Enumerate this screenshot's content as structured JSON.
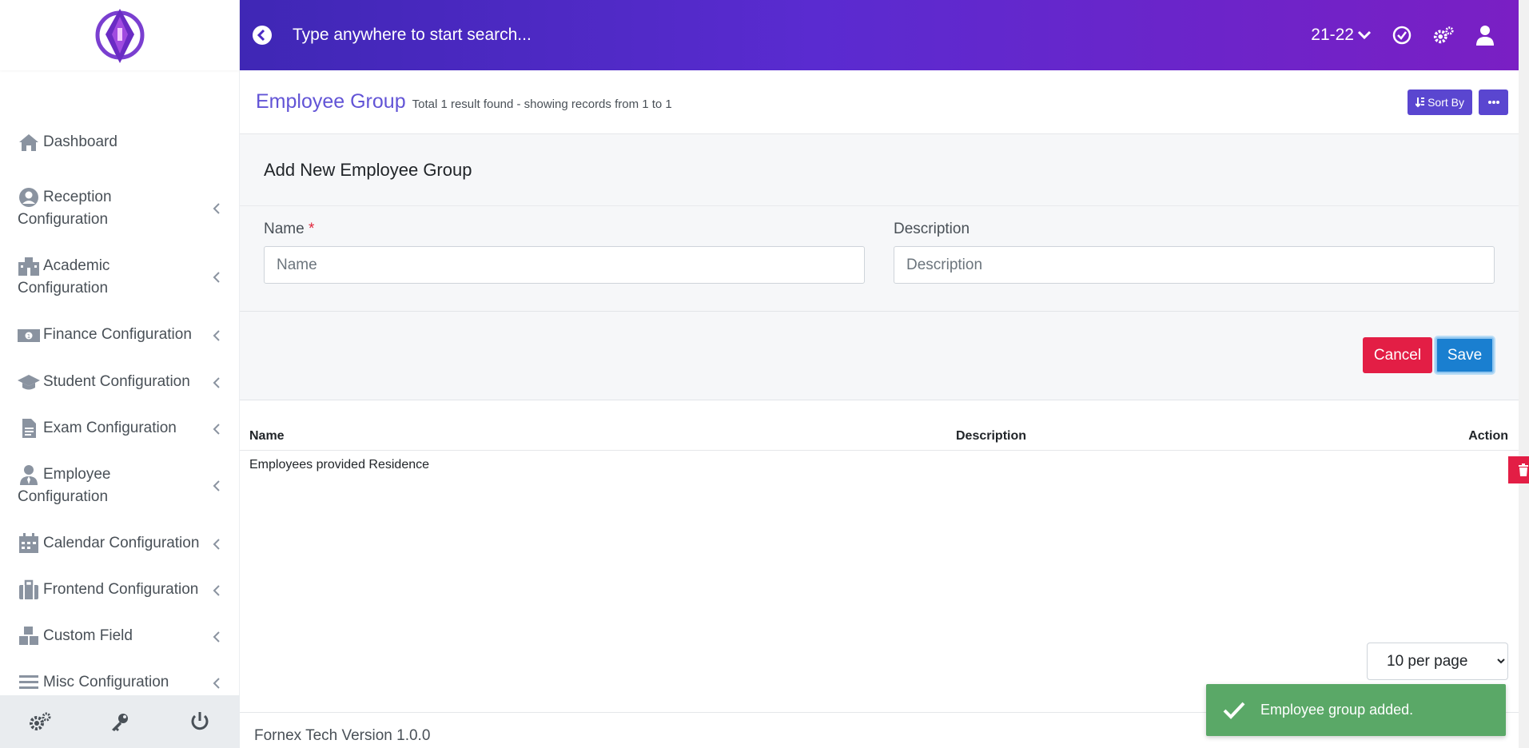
{
  "colors": {
    "brand": "#5a46d0",
    "topbar_gradient_start": "#3f27b5",
    "topbar_gradient_end": "#7a1fc4",
    "danger": "#e31e45",
    "primary": "#1a7fd0",
    "success": "#5aa867"
  },
  "topbar": {
    "search_placeholder": "Type anywhere to start search...",
    "academic_year": "21-22",
    "icons": [
      "back-arrow-icon",
      "chevron-down-icon",
      "check-circle-icon",
      "cogs-icon",
      "user-icon"
    ]
  },
  "sidebar": {
    "items": [
      {
        "label": "Dashboard",
        "icon": "home-icon",
        "has_submenu": false
      },
      {
        "label": "Reception Configuration",
        "icon": "user-circle-icon",
        "has_submenu": true
      },
      {
        "label": "Academic Configuration",
        "icon": "school-icon",
        "has_submenu": true
      },
      {
        "label": "Finance Configuration",
        "icon": "money-bill-icon",
        "has_submenu": true
      },
      {
        "label": "Student Configuration",
        "icon": "graduation-cap-icon",
        "has_submenu": true
      },
      {
        "label": "Exam Configuration",
        "icon": "file-icon",
        "has_submenu": true
      },
      {
        "label": "Employee Configuration",
        "icon": "user-tie-icon",
        "has_submenu": true
      },
      {
        "label": "Calendar Configuration",
        "icon": "calendar-icon",
        "has_submenu": true
      },
      {
        "label": "Frontend Configuration",
        "icon": "suitcase-icon",
        "has_submenu": true
      },
      {
        "label": "Custom Field",
        "icon": "cubes-icon",
        "has_submenu": true
      },
      {
        "label": "Misc Configuration",
        "icon": "bars-icon",
        "has_submenu": true
      }
    ],
    "footer_icons": [
      "settings-icon",
      "key-icon",
      "power-icon"
    ]
  },
  "page": {
    "title": "Employee Group",
    "subtitle": "Total 1 result found - showing records from 1 to 1",
    "sort_label": "Sort By"
  },
  "form": {
    "heading": "Add New Employee Group",
    "name_label": "Name",
    "name_required_mark": "*",
    "name_placeholder": "Name",
    "name_value": "",
    "description_label": "Description",
    "description_placeholder": "Description",
    "description_value": "",
    "cancel_label": "Cancel",
    "save_label": "Save"
  },
  "table": {
    "headers": {
      "name": "Name",
      "description": "Description",
      "action": "Action"
    },
    "rows": [
      {
        "name": "Employees provided Residence",
        "description": ""
      }
    ]
  },
  "pagination": {
    "per_page_options": [
      "10 per page"
    ],
    "per_page_selected": "10 per page"
  },
  "footer": {
    "version_text": "Fornex Tech Version 1.0.0"
  },
  "toast": {
    "message": "Employee group added."
  }
}
